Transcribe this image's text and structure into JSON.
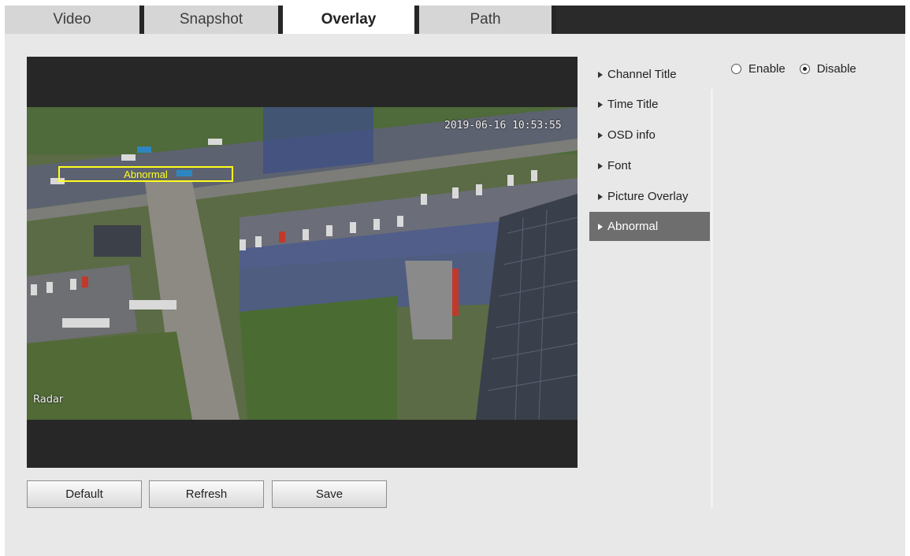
{
  "tabs": [
    {
      "label": "Video",
      "active": false
    },
    {
      "label": "Snapshot",
      "active": false
    },
    {
      "label": "Overlay",
      "active": true
    },
    {
      "label": "Path",
      "active": false
    }
  ],
  "preview": {
    "timestamp": "2019-06-16 10:53:55",
    "radar_label": "Radar",
    "abnormal_box_label": "Abnormal",
    "abnormal_box_color": "#ffff1e"
  },
  "menu": {
    "items": [
      {
        "label": "Channel Title",
        "active": false
      },
      {
        "label": "Time Title",
        "active": false
      },
      {
        "label": "OSD info",
        "active": false
      },
      {
        "label": "Font",
        "active": false
      },
      {
        "label": "Picture Overlay",
        "active": false
      },
      {
        "label": "Abnormal",
        "active": true
      }
    ]
  },
  "abnormal_setting": {
    "options": [
      {
        "label": "Enable",
        "selected": false
      },
      {
        "label": "Disable",
        "selected": true
      }
    ]
  },
  "buttons": {
    "default_label": "Default",
    "refresh_label": "Refresh",
    "save_label": "Save"
  },
  "colors": {
    "tab_bar_dark": "#2a2a2a",
    "panel_bg": "#e8e8e8",
    "menu_active_bg": "#6e6e6e"
  }
}
